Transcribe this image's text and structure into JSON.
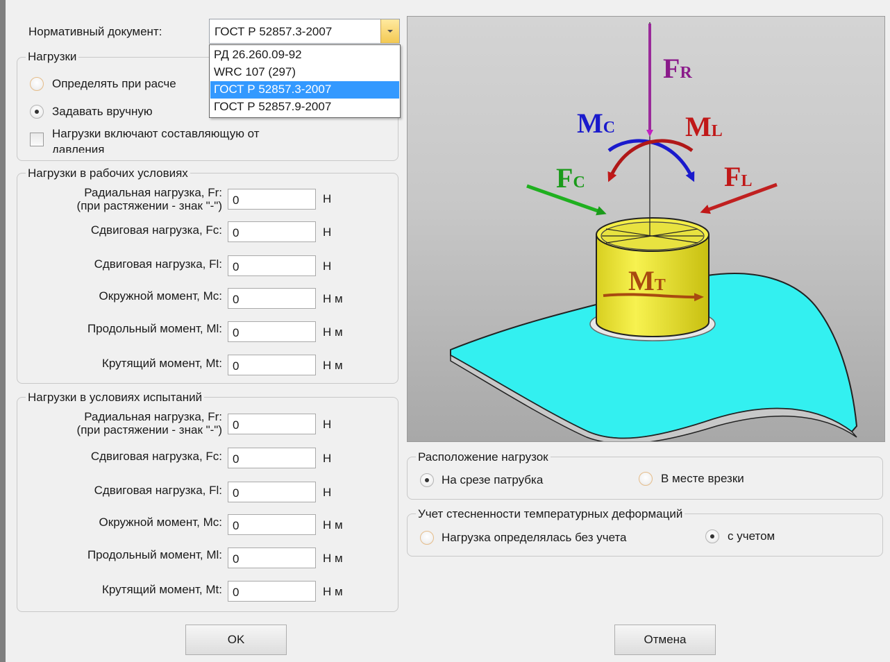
{
  "normative": {
    "label": "Нормативный документ:",
    "selected": "ГОСТ Р 52857.3-2007",
    "options": [
      "РД 26.260.09-92",
      "WRC 107 (297)",
      "ГОСТ Р 52857.3-2007",
      "ГОСТ Р 52857.9-2007"
    ],
    "selected_index": 2
  },
  "loads_group": {
    "title": "Нагрузки",
    "option_calc": "Определять при расче",
    "option_manual": "Задавать вручную",
    "checkbox_pressure": "Нагрузки включают составляющую от",
    "checkbox_pressure_line2": "давления",
    "selected": "manual"
  },
  "work_group": {
    "title": "Нагрузки в рабочих условиях",
    "fields": [
      {
        "label": "Радиальная нагрузка, Fr:",
        "label2": "(при растяжении - знак \"-\")",
        "value": "0",
        "unit": "Н"
      },
      {
        "label": "Сдвиговая нагрузка, Fc:",
        "value": "0",
        "unit": "Н"
      },
      {
        "label": "Сдвиговая нагрузка, Fl:",
        "value": "0",
        "unit": "Н"
      },
      {
        "label": "Окружной момент, Mc:",
        "value": "0",
        "unit": "Н м"
      },
      {
        "label": "Продольный момент, Ml:",
        "value": "0",
        "unit": "Н м"
      },
      {
        "label": "Крутящий момент, Mt:",
        "value": "0",
        "unit": "Н м"
      }
    ]
  },
  "test_group": {
    "title": "Нагрузки в условиях испытаний",
    "fields": [
      {
        "label": "Радиальная нагрузка, Fr:",
        "label2": "(при растяжении - знак \"-\")",
        "value": "0",
        "unit": "Н"
      },
      {
        "label": "Сдвиговая нагрузка, Fc:",
        "value": "0",
        "unit": "Н"
      },
      {
        "label": "Сдвиговая нагрузка, Fl:",
        "value": "0",
        "unit": "Н"
      },
      {
        "label": "Окружной момент, Mc:",
        "value": "0",
        "unit": "Н м"
      },
      {
        "label": "Продольный момент, Ml:",
        "value": "0",
        "unit": "Н м"
      },
      {
        "label": "Крутящий момент, Mt:",
        "value": "0",
        "unit": "Н м"
      }
    ]
  },
  "diagram": {
    "fr": {
      "main": "F",
      "sub": "R"
    },
    "mc": {
      "main": "M",
      "sub": "C"
    },
    "ml": {
      "main": "M",
      "sub": "L"
    },
    "fc": {
      "main": "F",
      "sub": "C"
    },
    "fl": {
      "main": "F",
      "sub": "L"
    },
    "mt": {
      "main": "M",
      "sub": "T"
    },
    "colors": {
      "fr": "#8a1a8a",
      "mc": "#1a1acc",
      "ml": "#c01818",
      "fc": "#1a9a1a",
      "fl": "#c01818",
      "mt": "#a84a10",
      "shell": "#33f0f0",
      "nozzle": "#f0ea3a"
    }
  },
  "location_group": {
    "title": "Расположение нагрузок",
    "option_cut": "На срезе патрубка",
    "option_insert": "В месте врезки",
    "selected": "cut"
  },
  "thermal_group": {
    "title": "Учет стесненности температурных деформаций",
    "option_without": "Нагрузка определялась без учета",
    "option_with": "с учетом",
    "selected": "with"
  },
  "buttons": {
    "ok": "OK",
    "cancel": "Отмена"
  }
}
